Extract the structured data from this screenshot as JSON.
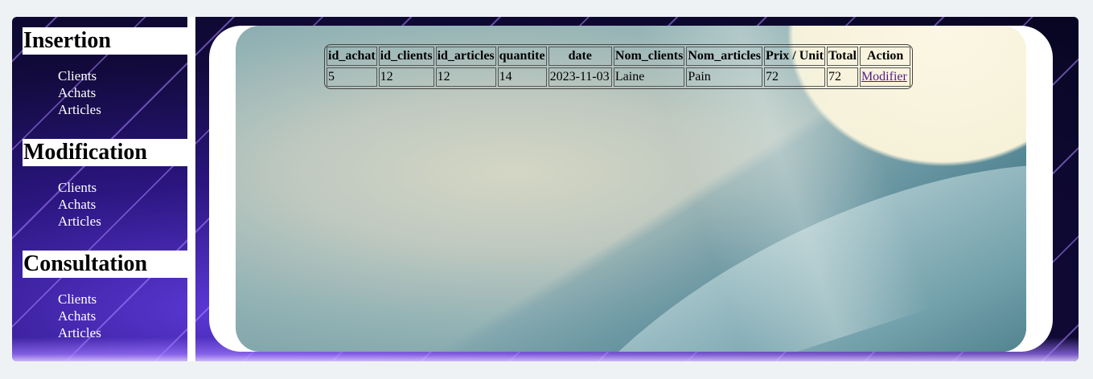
{
  "sidebar": {
    "sections": [
      {
        "title": "Insertion",
        "items": [
          "Clients",
          "Achats",
          "Articles"
        ]
      },
      {
        "title": "Modification",
        "items": [
          "Clients",
          "Achats",
          "Articles"
        ]
      },
      {
        "title": "Consultation",
        "items": [
          "Clients",
          "Achats",
          "Articles"
        ]
      }
    ]
  },
  "table": {
    "headers": [
      "id_achat",
      "id_clients",
      "id_articles",
      "quantite",
      "date",
      "Nom_clients",
      "Nom_articles",
      "Prix / Unit",
      "Total",
      "Action"
    ],
    "rows": [
      {
        "id_achat": "5",
        "id_clients": "12",
        "id_articles": "12",
        "quantite": "14",
        "date": "2023-11-03",
        "nom_clients": "Laine",
        "nom_articles": "Pain",
        "prix_unit": "72",
        "total": "72",
        "action": "Modifier"
      }
    ]
  }
}
